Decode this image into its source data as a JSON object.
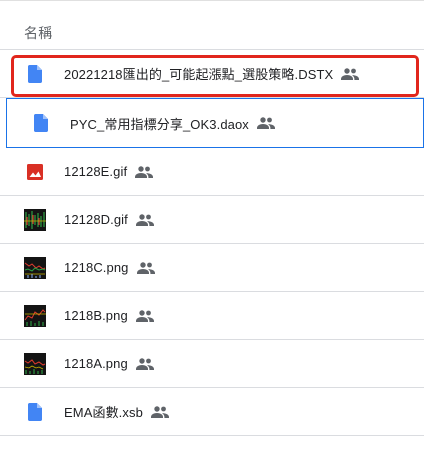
{
  "header": {
    "name_label": "名稱"
  },
  "files": [
    {
      "name": "20221218匯出的_可能起漲點_選股策略.DSTX",
      "icon": "doc-file-icon",
      "shared": true,
      "highlighted": true
    },
    {
      "name": "PYC_常用指標分享_OK3.daox",
      "icon": "doc-file-icon",
      "shared": true,
      "selected": true
    },
    {
      "name": "12128E.gif",
      "icon": "image-file-icon",
      "shared": true
    },
    {
      "name": "12128D.gif",
      "icon": "image-thumbnail",
      "shared": true
    },
    {
      "name": "1218C.png",
      "icon": "image-thumbnail",
      "shared": true
    },
    {
      "name": "1218B.png",
      "icon": "image-thumbnail",
      "shared": true
    },
    {
      "name": "1218A.png",
      "icon": "image-thumbnail",
      "shared": true
    },
    {
      "name": "EMA函數.xsb",
      "icon": "doc-file-icon",
      "shared": true
    }
  ],
  "colors": {
    "doc_blue": "#4285f4",
    "image_red": "#d93025",
    "highlight_red": "#e1261c",
    "selected_border": "#1a73e8",
    "shared_icon": "#5f6368"
  }
}
